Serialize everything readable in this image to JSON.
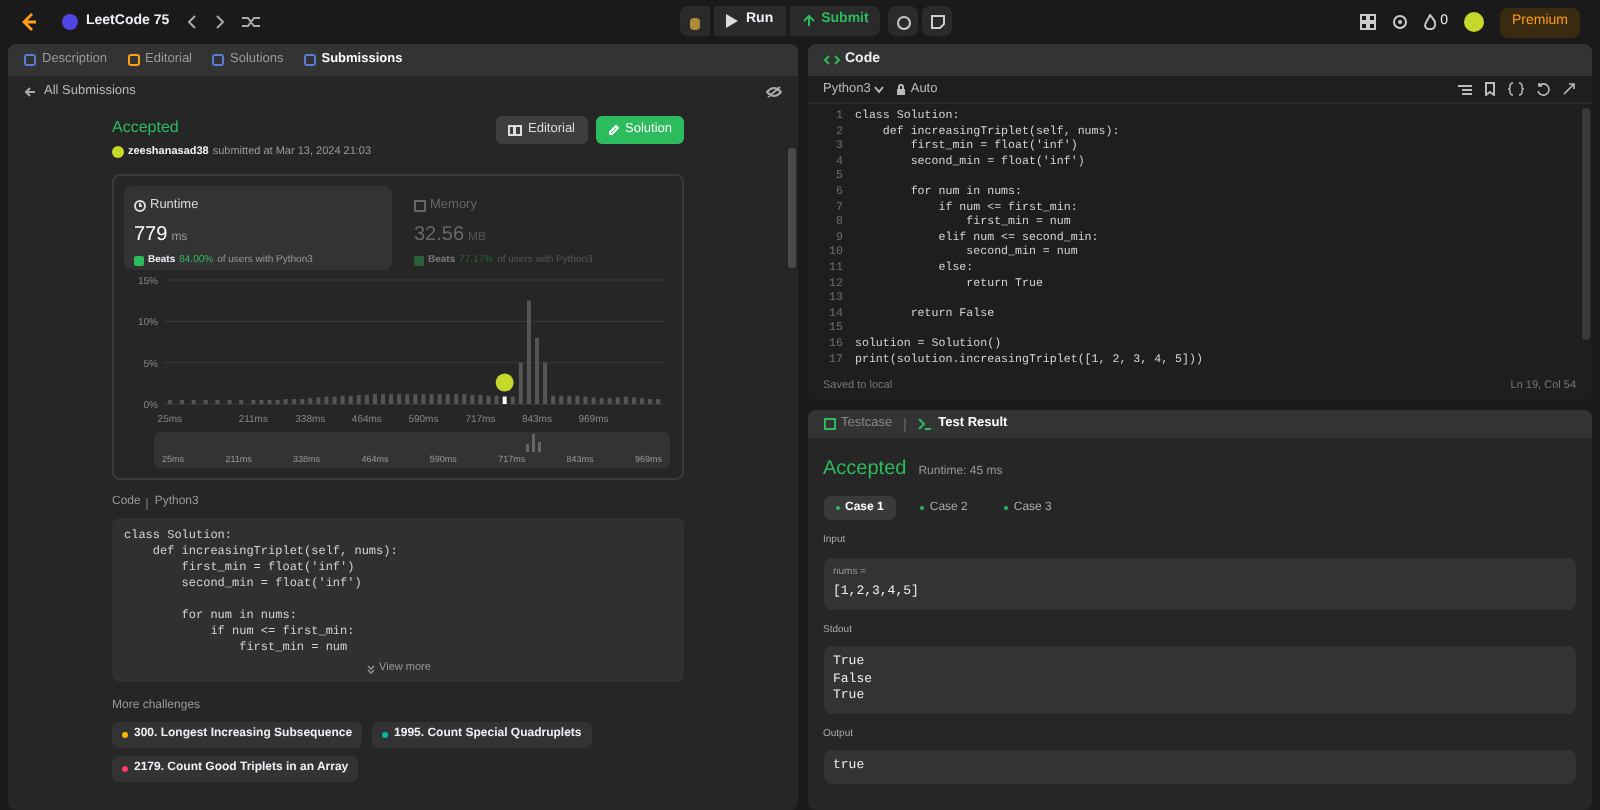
{
  "top_bar": {
    "problem_list": "LeetCode 75",
    "run": "Run",
    "submit": "Submit",
    "streak": "0",
    "premium": "Premium"
  },
  "left_tabs": [
    {
      "label": "Description",
      "selected": false
    },
    {
      "label": "Editorial",
      "selected": false
    },
    {
      "label": "Solutions",
      "selected": false
    },
    {
      "label": "Submissions",
      "selected": true
    }
  ],
  "back_link": "All Submissions",
  "submission": {
    "status": "Accepted",
    "user": "zeeshanasad38",
    "submitted": "submitted at Mar 13, 2024 21:03",
    "buttons": [
      {
        "label": "Editorial",
        "kind": "secondary"
      },
      {
        "label": "Solution",
        "kind": "primary"
      }
    ]
  },
  "stats": [
    {
      "label": "Runtime",
      "value": "779",
      "unit": "ms",
      "beats": "Beats",
      "percent": "84.00%",
      "rest": "of users with Python3",
      "selected": true
    },
    {
      "label": "Memory",
      "value": "32.56",
      "unit": "MB",
      "beats": "Beats",
      "percent": "77.17%",
      "rest": "of users with Python3",
      "selected": false
    }
  ],
  "chart_data": {
    "type": "bar",
    "ylim": [
      0,
      15
    ],
    "yticks": [
      {
        "value": 0,
        "label": "0%"
      },
      {
        "value": 5,
        "label": "5%"
      },
      {
        "value": 10,
        "label": "10%"
      },
      {
        "value": 15,
        "label": "15%"
      }
    ],
    "x": [
      25,
      52,
      78,
      105,
      131,
      158,
      184,
      211,
      229,
      247,
      265,
      283,
      302,
      320,
      338,
      356,
      374,
      392,
      410,
      428,
      446,
      464,
      482,
      500,
      518,
      536,
      554,
      572,
      590,
      608,
      626,
      644,
      663,
      681,
      699,
      717,
      735,
      753,
      771,
      789,
      807,
      825,
      843,
      861,
      879,
      897,
      915,
      933,
      951,
      969,
      987,
      1005,
      1023,
      1041,
      1059,
      1077,
      1095,
      1113
    ],
    "xlim": [
      12,
      1126
    ],
    "xticks": [
      {
        "value": 25,
        "label": "25ms"
      },
      {
        "value": 211,
        "label": "211ms"
      },
      {
        "value": 338,
        "label": "338ms"
      },
      {
        "value": 464,
        "label": "464ms"
      },
      {
        "value": 590,
        "label": "590ms"
      },
      {
        "value": 717,
        "label": "717ms"
      },
      {
        "value": 843,
        "label": "843ms"
      },
      {
        "value": 969,
        "label": "969ms"
      }
    ],
    "values": [
      0.5,
      0.5,
      0.5,
      0.5,
      0.5,
      0.5,
      0.5,
      0.5,
      0.5,
      0.5,
      0.5,
      0.6,
      0.6,
      0.6,
      0.7,
      0.8,
      0.9,
      0.9,
      1.0,
      1.0,
      1.1,
      1.1,
      1.2,
      1.2,
      1.2,
      1.2,
      1.2,
      1.2,
      1.2,
      1.2,
      1.2,
      1.2,
      1.2,
      1.2,
      1.1,
      1.1,
      1.0,
      1.0,
      0.9,
      0.9,
      5.0,
      12.5,
      8.0,
      5.0,
      1.0,
      1.0,
      1.0,
      1.0,
      0.9,
      0.8,
      0.7,
      0.7,
      0.8,
      0.9,
      0.8,
      0.7,
      0.6,
      0.6
    ]
  },
  "range_labels": [
    "25ms",
    "211ms",
    "338ms",
    "464ms",
    "590ms",
    "717ms",
    "843ms",
    "969ms"
  ],
  "code_header": {
    "label": "Code",
    "language": "Python3"
  },
  "code_preview": [
    {
      "kind": "code",
      "code": "class Solution:"
    },
    {
      "kind": "code",
      "code": "    def increasingTriplet(self, nums):"
    },
    {
      "kind": "code",
      "code": "        first_min = float('inf')"
    },
    {
      "kind": "code",
      "code": "        second_min = float('inf')"
    },
    {
      "kind": "blank"
    },
    {
      "kind": "code",
      "code": "        for num in nums:"
    },
    {
      "kind": "code",
      "code": "            if num <= first_min:"
    },
    {
      "kind": "code",
      "code": "                first_min = num"
    }
  ],
  "view_more": "View more",
  "more_challenges": {
    "title": "More challenges",
    "items": [
      {
        "label": "300. Longest Increasing Subsequence",
        "color": "#ffb800"
      },
      {
        "label": "1995. Count Special Quadruplets",
        "color": "#00b8a3"
      },
      {
        "label": "2179. Count Good Triplets in an Array",
        "color": "#ff375f"
      }
    ]
  },
  "code_panel": {
    "title": "Code",
    "language": "Python3",
    "mode": "Auto",
    "lines": [
      {
        "n": "1",
        "kind": "code",
        "code": "class Solution:"
      },
      {
        "n": "2",
        "kind": "code",
        "code": "    def increasingTriplet(self, nums):"
      },
      {
        "n": "3",
        "kind": "code",
        "code": "        first_min = float('inf')"
      },
      {
        "n": "4",
        "kind": "code",
        "code": "        second_min = float('inf')"
      },
      {
        "n": "5",
        "kind": "blank"
      },
      {
        "n": "6",
        "kind": "code",
        "code": "        for num in nums:"
      },
      {
        "n": "7",
        "kind": "code",
        "code": "            if num <= first_min:"
      },
      {
        "n": "8",
        "kind": "code",
        "code": "                first_min = num"
      },
      {
        "n": "9",
        "kind": "code",
        "code": "            elif num <= second_min:"
      },
      {
        "n": "10",
        "kind": "code",
        "code": "                second_min = num"
      },
      {
        "n": "11",
        "kind": "code",
        "code": "            else:"
      },
      {
        "n": "12",
        "kind": "code",
        "code": "                return True"
      },
      {
        "n": "13",
        "kind": "blank"
      },
      {
        "n": "14",
        "kind": "code",
        "code": "        return False"
      },
      {
        "n": "15",
        "kind": "blank"
      },
      {
        "n": "16",
        "kind": "code",
        "code": "solution = Solution()"
      },
      {
        "n": "17",
        "kind": "code",
        "code": "print(solution.increasingTriplet([1, 2, 3, 4, 5]))"
      }
    ],
    "status": "Saved to local",
    "cursor": "Ln 19, Col 54"
  },
  "result_panel": {
    "tabs": [
      {
        "label": "Testcase",
        "selected": false
      },
      {
        "label": "Test Result",
        "selected": true
      }
    ],
    "status": "Accepted",
    "runtime": "Runtime: 45 ms",
    "cases": [
      {
        "label": "Case 1",
        "selected": true
      },
      {
        "label": "Case 2",
        "selected": false
      },
      {
        "label": "Case 3",
        "selected": false
      }
    ],
    "sections": [
      {
        "label": "Input",
        "param": "nums =",
        "value": "[1,2,3,4,5]"
      },
      {
        "label": "Stdout",
        "value": "True\nFalse\nTrue"
      },
      {
        "label": "Output",
        "value": "true"
      }
    ]
  }
}
